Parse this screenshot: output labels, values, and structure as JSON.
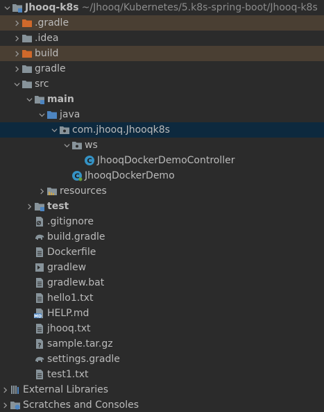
{
  "project": {
    "name": "Jhooq-k8s",
    "path": "~/Jhooq/Kubernetes/5.k8s-spring-boot/Jhooq-k8s"
  },
  "items": {
    "gradle_hidden": ".gradle",
    "idea": ".idea",
    "build": "build",
    "gradle": "gradle",
    "src": "src",
    "main": "main",
    "java": "java",
    "package": "com.jhooq.Jhooqk8s",
    "ws": "ws",
    "controller": "JhooqDockerDemoController",
    "demo": "JhooqDockerDemo",
    "resources": "resources",
    "test": "test",
    "gitignore": ".gitignore",
    "build_gradle": "build.gradle",
    "dockerfile": "Dockerfile",
    "gradlew": "gradlew",
    "gradlew_bat": "gradlew.bat",
    "hello1": "hello1.txt",
    "help": "HELP.md",
    "jhooq": "jhooq.txt",
    "sample": "sample.tar.gz",
    "settings_gradle": "settings.gradle",
    "test1": "test1.txt",
    "external_libraries": "External Libraries",
    "scratches": "Scratches and Consoles"
  },
  "colors": {
    "background": "#2b2b2b",
    "selected_row": "#0d293e",
    "excluded_row": "#4a3f33",
    "folder": "#87939a",
    "excluded_folder": "#d0692b",
    "source_folder": "#4d85c1",
    "class_icon": "#3592c4"
  }
}
